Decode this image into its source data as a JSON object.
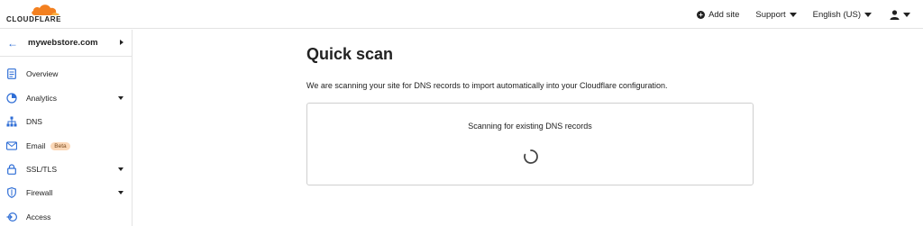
{
  "header": {
    "logo_text": "CLOUDFLARE",
    "add_site": "Add site",
    "support": "Support",
    "language": "English (US)"
  },
  "sidebar": {
    "site_name": "mywebstore.com",
    "items": [
      {
        "label": "Overview",
        "icon": "document-icon",
        "has_caret": false
      },
      {
        "label": "Analytics",
        "icon": "pie-chart-icon",
        "has_caret": true
      },
      {
        "label": "DNS",
        "icon": "network-icon",
        "has_caret": false
      },
      {
        "label": "Email",
        "icon": "email-icon",
        "has_caret": false,
        "badge": "Beta"
      },
      {
        "label": "SSL/TLS",
        "icon": "lock-icon",
        "has_caret": true
      },
      {
        "label": "Firewall",
        "icon": "shield-icon",
        "has_caret": true
      },
      {
        "label": "Access",
        "icon": "access-icon",
        "has_caret": false
      }
    ]
  },
  "main": {
    "title": "Quick scan",
    "description": "We are scanning your site for DNS records to import automatically into your Cloudflare configuration.",
    "scan_status": "Scanning for existing DNS records"
  },
  "colors": {
    "accent": "#2f6ed6",
    "logo_orange": "#f38020",
    "logo_light": "#faae40",
    "badge_bg": "#fbd8b8"
  }
}
